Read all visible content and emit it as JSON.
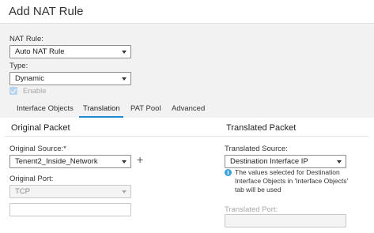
{
  "dialog": {
    "title": "Add NAT Rule"
  },
  "rule_form": {
    "nat_rule_label": "NAT Rule:",
    "nat_rule_value": "Auto NAT Rule",
    "type_label": "Type:",
    "type_value": "Dynamic",
    "enable_label": "Enable",
    "enable_checked": true
  },
  "tabs": [
    {
      "label": "Interface Objects",
      "active": false
    },
    {
      "label": "Translation",
      "active": true
    },
    {
      "label": "PAT Pool",
      "active": false
    },
    {
      "label": "Advanced",
      "active": false
    }
  ],
  "original_packet": {
    "title": "Original Packet",
    "source_label": "Original Source:*",
    "source_value": "Tenent2_Inside_Network",
    "port_label": "Original Port:",
    "port_value": "TCP",
    "port_input_value": ""
  },
  "translated_packet": {
    "title": "Translated Packet",
    "source_label": "Translated Source:",
    "source_value": "Destination Interface IP",
    "info_text": "The values selected for Destination Interface Objects in 'Interface Objects' tab will be used",
    "port_label": "Translated Port:",
    "port_value": ""
  },
  "colors": {
    "accent": "#1d8bd2",
    "info": "#3aa0dc",
    "checkbox": "#b8d4ee"
  }
}
